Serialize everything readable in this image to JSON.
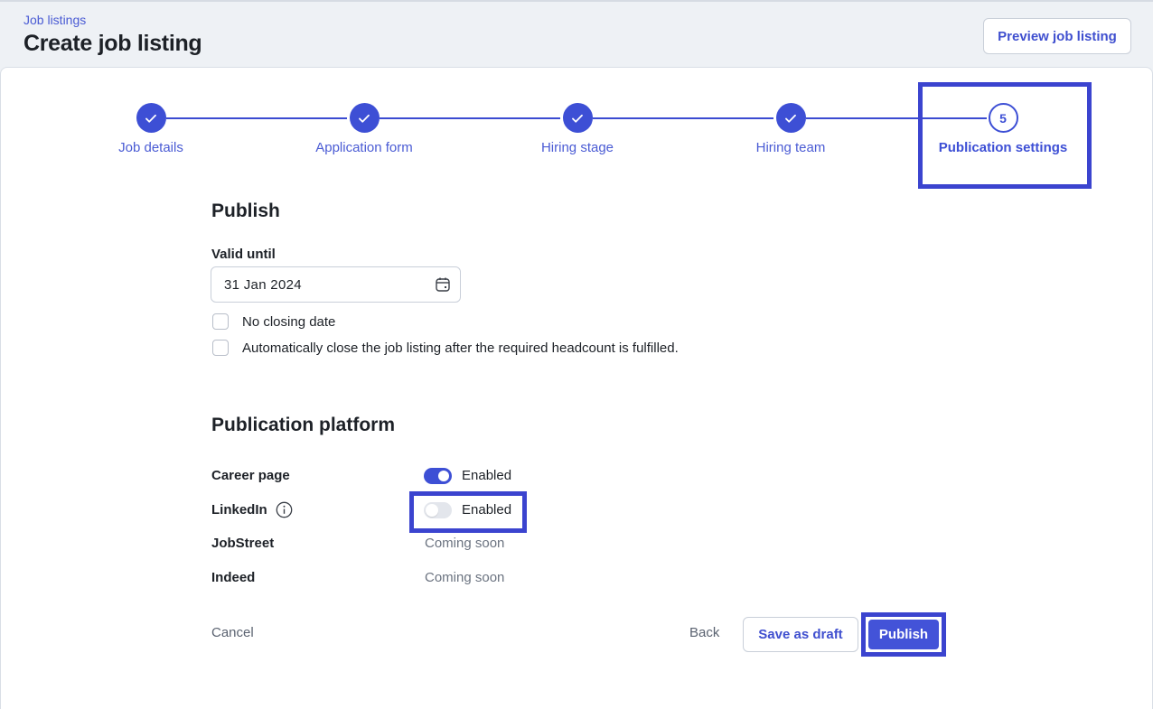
{
  "header": {
    "breadcrumb": "Job listings",
    "title": "Create job listing",
    "preview_label": "Preview job listing"
  },
  "stepper": {
    "steps": [
      {
        "label": "Job details",
        "status": "done"
      },
      {
        "label": "Application form",
        "status": "done"
      },
      {
        "label": "Hiring stage",
        "status": "done"
      },
      {
        "label": "Hiring team",
        "status": "done"
      },
      {
        "label": "Publication settings",
        "status": "current",
        "number": "5"
      }
    ]
  },
  "publish": {
    "title": "Publish",
    "valid_until_label": "Valid until",
    "valid_until_value": "31 Jan 2024",
    "no_closing_label": "No closing date",
    "auto_close_label": "Automatically close the job listing after the required headcount is fulfilled."
  },
  "platforms": {
    "title": "Publication platform",
    "items": [
      {
        "name": "Career page",
        "status": "Enabled",
        "enabled": true
      },
      {
        "name": "LinkedIn",
        "status": "Enabled",
        "enabled": false
      },
      {
        "name": "JobStreet",
        "status": "Coming soon"
      },
      {
        "name": "Indeed",
        "status": "Coming soon"
      }
    ]
  },
  "footer": {
    "cancel": "Cancel",
    "back": "Back",
    "save_draft": "Save as draft",
    "publish": "Publish"
  },
  "colors": {
    "accent": "#3d4fd5",
    "highlight": "#3b44cf"
  }
}
